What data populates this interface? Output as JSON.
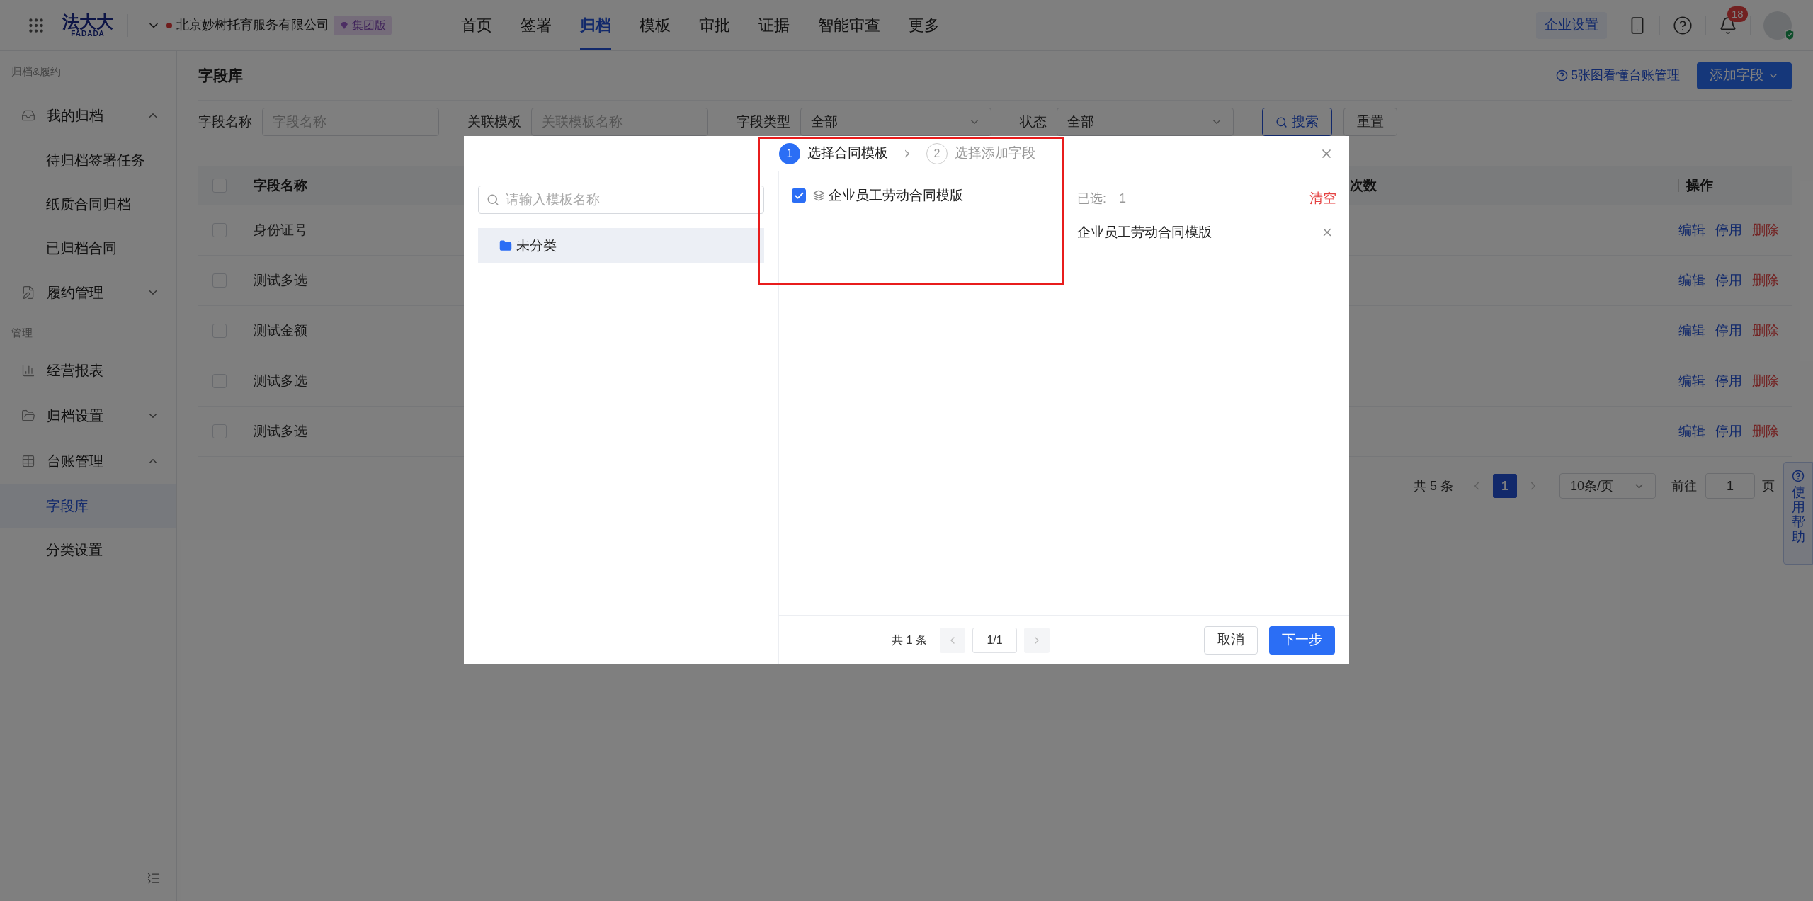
{
  "top_bar": {
    "logo_text": "法大大",
    "logo_subtext": "FADADA",
    "company": "北京妙树托育服务有限公司",
    "edition_badge": "集团版",
    "nav": [
      {
        "label": "首页",
        "selected": false
      },
      {
        "label": "签署",
        "selected": false
      },
      {
        "label": "归档",
        "selected": true
      },
      {
        "label": "模板",
        "selected": false
      },
      {
        "label": "审批",
        "selected": false
      },
      {
        "label": "证据",
        "selected": false
      },
      {
        "label": "智能审查",
        "selected": false
      },
      {
        "label": "更多",
        "selected": false
      }
    ],
    "settings_button": "企业设置",
    "notification_count": "18"
  },
  "sidebar": {
    "sections": [
      {
        "title": "归档&履约",
        "items": [
          {
            "label": "我的归档",
            "expanded": true,
            "children": [
              {
                "label": "待归档签署任务",
                "selected": false
              },
              {
                "label": "纸质合同归档",
                "selected": false
              },
              {
                "label": "已归档合同",
                "selected": false
              }
            ]
          },
          {
            "label": "履约管理",
            "expanded": false
          }
        ]
      },
      {
        "title": "管理",
        "items": [
          {
            "label": "经营报表"
          },
          {
            "label": "归档设置",
            "expanded": false
          },
          {
            "label": "台账管理",
            "expanded": true,
            "children": [
              {
                "label": "字段库",
                "selected": true
              },
              {
                "label": "分类设置",
                "selected": false
              }
            ]
          }
        ]
      }
    ]
  },
  "page": {
    "title": "字段库",
    "help_link": "5张图看懂台账管理",
    "add_button": "添加字段"
  },
  "filters": [
    {
      "kind": "input",
      "label": "字段名称",
      "placeholder": "字段名称"
    },
    {
      "kind": "input",
      "label": "关联模板",
      "placeholder": "关联模板名称"
    },
    {
      "kind": "select",
      "label": "字段类型",
      "value": "全部"
    },
    {
      "kind": "select",
      "label": "状态",
      "value": "全部"
    }
  ],
  "filter_buttons": [
    {
      "kind": "primary",
      "label": "搜索"
    },
    {
      "kind": "default",
      "label": "重置"
    }
  ],
  "table": {
    "all_checked": false,
    "columns": [
      "字段名称",
      "次数",
      "操作"
    ],
    "rows": [
      {
        "checked": false,
        "name": "身份证号",
        "actions": [
          {
            "kind": "link",
            "label": "编辑"
          },
          {
            "kind": "link",
            "label": "停用"
          },
          {
            "kind": "danger",
            "label": "删除"
          }
        ]
      },
      {
        "checked": false,
        "name": "测试多选",
        "actions": [
          {
            "kind": "link",
            "label": "编辑"
          },
          {
            "kind": "link",
            "label": "停用"
          },
          {
            "kind": "danger",
            "label": "删除"
          }
        ]
      },
      {
        "checked": false,
        "name": "测试金额",
        "actions": [
          {
            "kind": "link",
            "label": "编辑"
          },
          {
            "kind": "link",
            "label": "停用"
          },
          {
            "kind": "danger",
            "label": "删除"
          }
        ]
      },
      {
        "checked": false,
        "name": "测试多选",
        "actions": [
          {
            "kind": "link",
            "label": "编辑"
          },
          {
            "kind": "link",
            "label": "停用"
          },
          {
            "kind": "danger",
            "label": "删除"
          }
        ]
      },
      {
        "checked": false,
        "name": "测试多选",
        "actions": [
          {
            "kind": "link",
            "label": "编辑"
          },
          {
            "kind": "link",
            "label": "停用"
          },
          {
            "kind": "danger",
            "label": "删除"
          }
        ]
      }
    ]
  },
  "pagination": {
    "total": "共 5 条",
    "pages": [
      {
        "label": "1",
        "selected": true
      }
    ],
    "page_size": "10条/页",
    "goto_label": "前往",
    "goto_value": "1",
    "goto_suffix": "页"
  },
  "help_tab": "使用帮助",
  "modal": {
    "steps": [
      {
        "number": "1",
        "label": "选择合同模板",
        "selected": true
      },
      {
        "number": "2",
        "label": "选择添加字段",
        "selected": false
      }
    ],
    "search_placeholder": "请输入模板名称",
    "categories": [
      {
        "label": "未分类",
        "selected": true
      }
    ],
    "templates": [
      {
        "label": "企业员工劳动合同模版",
        "checked": true
      }
    ],
    "template_pagination": {
      "total": "共 1 条",
      "page": "1/1"
    },
    "selected_label": "已选:",
    "selected_count": "1",
    "clear": "清空",
    "selected_items": [
      "企业员工劳动合同模版"
    ],
    "buttons": [
      {
        "kind": "default",
        "label": "取消"
      },
      {
        "kind": "primary",
        "label": "下一步"
      }
    ]
  }
}
